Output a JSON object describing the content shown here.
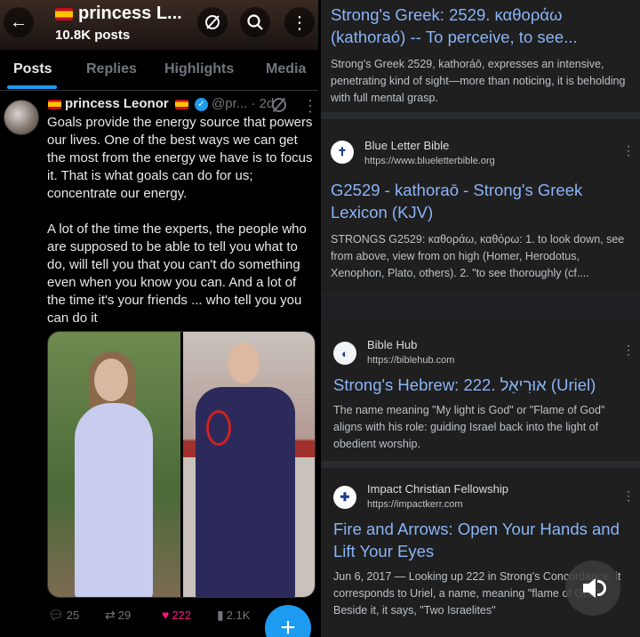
{
  "left": {
    "header": {
      "title": "princess L...",
      "subtitle": "10.8K posts",
      "back_icon": "←",
      "search_icon": "⌕",
      "more_icon": "⋮"
    },
    "tabs": [
      {
        "label": "Posts",
        "active": true
      },
      {
        "label": "Replies",
        "active": false
      },
      {
        "label": "Highlights",
        "active": false
      },
      {
        "label": "Media",
        "active": false
      }
    ],
    "post": {
      "author_name": "princess Leonor",
      "handle": "@pr...",
      "time": "· 2d",
      "body_paragraphs": [
        "Goals provide the energy source that powers our lives. One of the best ways we can get the most from the energy we have is to focus it. That is what goals can do for us; concentrate our energy.",
        "A lot of the time the experts, the people who are supposed to be able to tell you what to do, will tell you that you can't do something even when you know you can. And a lot of the time it's your friends ... who tell you you can do it"
      ],
      "replies": "25",
      "reposts": "29",
      "likes": "222",
      "views": "2.1K"
    },
    "fab_label": "+"
  },
  "right": {
    "results": [
      {
        "title": "Strong's Greek: 2529. καθοράω (kathoraó) -- To perceive, to see...",
        "snippet": "Strong's Greek 2529, kathoráō, expresses an intensive, penetrating kind of sight—more than noticing, it is beholding with full mental grasp."
      },
      {
        "site_name": "Blue Letter Bible",
        "site_url": "https://www.blueletterbible.org",
        "title": "G2529 - kathoraō - Strong's Greek Lexicon (KJV)",
        "snippet": "STRONGS G2529: καθοράω, καθόρω: 1. to look down, see from above, view from on high (Homer, Herodotus, Xenophon, Plato, others). 2. \"to see thoroughly (cf...."
      },
      {
        "site_name": "Bible Hub",
        "site_url": "https://biblehub.com",
        "title": "Strong's Hebrew: 222. אוּרִיאֵל (Uriel)",
        "snippet": "The name meaning \"My light is God\" or \"Flame of God\" aligns with his role: guiding Israel back into the light of obedient worship."
      },
      {
        "site_name": "Impact Christian Fellowship",
        "site_url": "https://impactkerr.com",
        "title": "Fire and Arrows: Open Your Hands and Lift Your Eyes",
        "snippet": "Jun 6, 2017 — Looking up 222 in Strong's Concordance, it corresponds to Uriel, a name, meaning \"flame of God\". Beside it, it says, \"Two Israelites\""
      }
    ]
  },
  "colors": {
    "x_accent": "#1d9bf0",
    "like": "#f91880",
    "link": "#8ab4f8",
    "results_bg": "#1f1f1f"
  }
}
